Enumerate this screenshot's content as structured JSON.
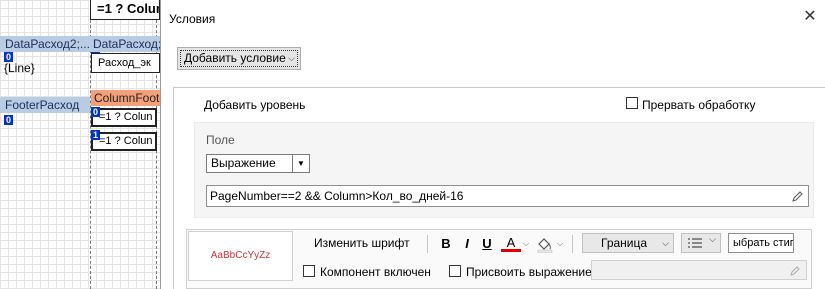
{
  "designer": {
    "top_cell": "=1 ? Colum",
    "data_band_left": "DataРасход2;...",
    "data_band_right": "DataРасход;",
    "data_num_left": "0",
    "data_num_right": "0",
    "line_text": "{Line}",
    "cell_text": "Расход_эк",
    "footer_band": "FooterРасход",
    "footer_num": "0",
    "column_footer": "ColumnFoote",
    "cell_num_0": "0",
    "cell_num_1": "1",
    "cell_1": "=1 ? Colun",
    "cell_2": "=1 ? Colun"
  },
  "dialog": {
    "title": "Условия",
    "close_icon": "close-icon",
    "add_condition_label": "Добавить условие",
    "add_level_label": "Добавить уровень",
    "break_processing_label": "Прервать обработку",
    "break_processing_checked": false,
    "field": {
      "title": "Поле",
      "selected": "Выражение",
      "expression": "PageNumber==2 && Column>Кол_во_дней-16"
    },
    "style": {
      "sample_text": "AaBbCcYyZz",
      "change_font_label": "Изменить шрифт",
      "bold": "B",
      "italic": "I",
      "underline": "U",
      "font_color_glyph": "A",
      "border_label": "Граница",
      "style_select_value": "ыбрать стиг",
      "component_enabled_label": "Компонент включен",
      "component_enabled_checked": false,
      "assign_expression_label": "Присвоить выражение",
      "assign_expression_checked": false,
      "assign_expression_value": ""
    },
    "colors": {
      "font_color": "#e00000",
      "sample_color": "#d03030",
      "band_blue": "#b8cce4",
      "band_orange": "#f4a07a",
      "num_badge": "#0033cc"
    }
  }
}
